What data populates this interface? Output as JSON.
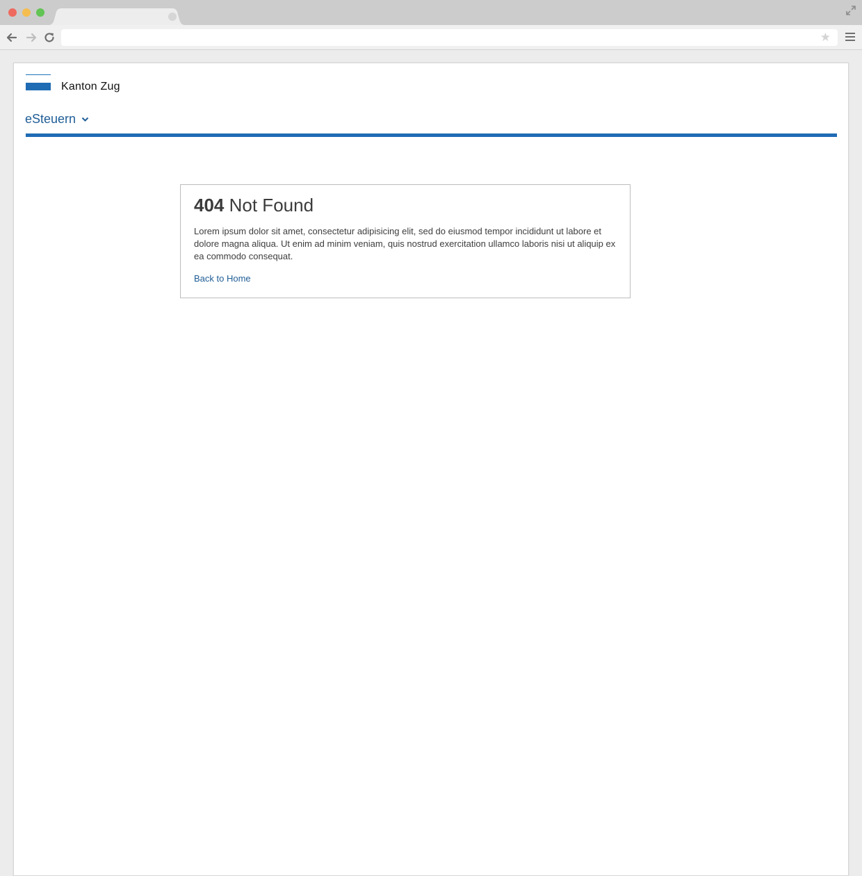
{
  "browser": {
    "icons": {
      "back": "arrow-left-icon",
      "forward": "arrow-right-icon",
      "reload": "reload-icon",
      "bookmark": "star-icon",
      "menu": "hamburger-menu-icon",
      "fullscreen": "expand-icon"
    }
  },
  "header": {
    "brand_name": "Kanton Zug",
    "service_menu_label": "eSteuern",
    "accent_color": "#1f6bb4"
  },
  "error": {
    "code": "404",
    "title": "Not Found",
    "description": "Lorem ipsum dolor sit amet, consectetur adipisicing elit, sed do eiusmod tempor incididunt ut labore et dolore magna aliqua. Ut enim ad minim veniam, quis nostrud exercitation ullamco laboris nisi ut aliquip ex ea commodo consequat.",
    "back_link_label": "Back to Home"
  }
}
